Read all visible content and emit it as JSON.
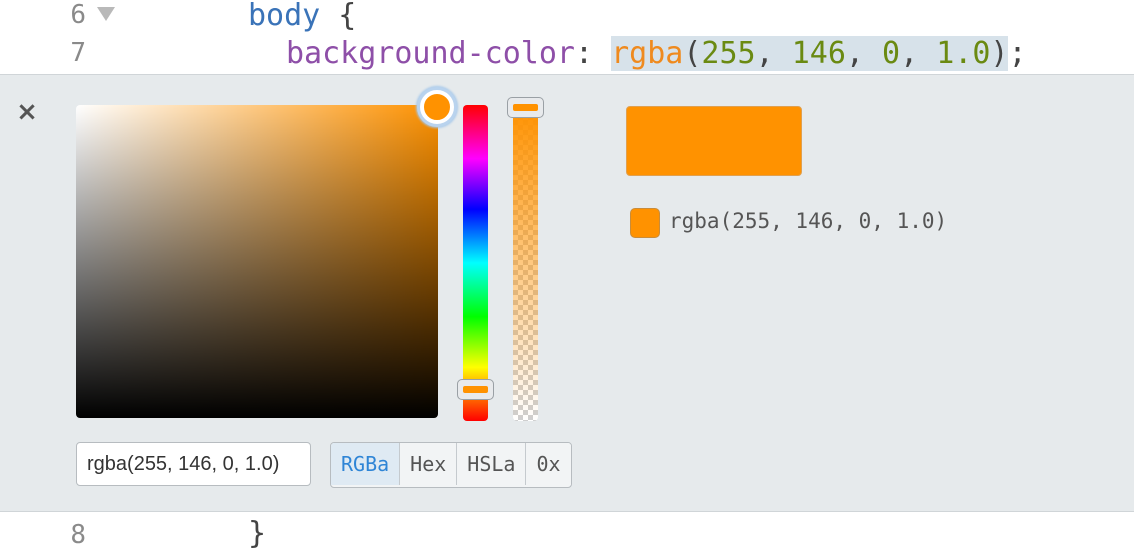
{
  "editor": {
    "lines": [
      {
        "number": "6",
        "text": {
          "selector": "body",
          "brace": " {"
        }
      },
      {
        "number": "7",
        "text": {
          "property": "background-color",
          "colon": ": ",
          "fn": "rgba",
          "open": "(",
          "r": "255",
          "sep1": ", ",
          "g": "146",
          "sep2": ", ",
          "b": "0",
          "sep3": ", ",
          "a": "1.0",
          "close": ")",
          "semi": ";"
        }
      },
      {
        "number": "8",
        "text": {
          "brace": "}"
        }
      }
    ]
  },
  "picker": {
    "close_label": "×",
    "current_color_hex": "#ff9200",
    "hue_degrees": 34,
    "saturation": 1.0,
    "brightness": 1.0,
    "alpha": 1.0,
    "input_value": "rgba(255, 146, 0, 1.0)",
    "formats": [
      {
        "label": "RGBa",
        "active": true
      },
      {
        "label": "Hex",
        "active": false
      },
      {
        "label": "HSLa",
        "active": false
      },
      {
        "label": "0x",
        "active": false
      }
    ],
    "history": [
      {
        "label": "rgba(255, 146, 0, 1.0)",
        "color": "#ff9200"
      }
    ]
  },
  "colors": {
    "selector": "#3a73b8",
    "property": "#8e4fa8",
    "function": "#ef8a1e",
    "number": "#6a8a12",
    "active_format": "#2f85d6"
  }
}
